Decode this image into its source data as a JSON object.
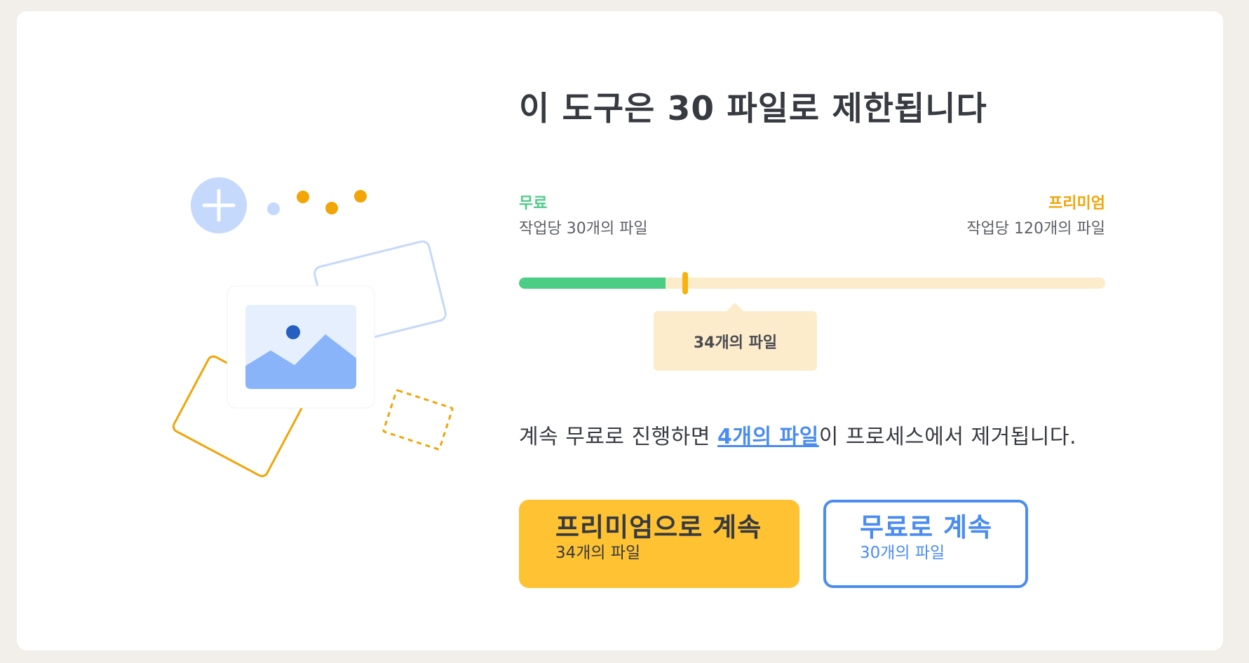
{
  "title": "이 도구은 30 파일로 제한됩니다",
  "plans": {
    "free": {
      "label": "무료",
      "desc": "작업당 30개의 파일",
      "color": "#4ccd86"
    },
    "premium": {
      "label": "프리미엄",
      "desc": "작업당 120개의 파일",
      "color": "#f1a508"
    }
  },
  "usage": {
    "free_limit_fraction": 0.25,
    "current_fraction": 0.2833,
    "tooltip": "34개의 파일"
  },
  "message": {
    "prefix": "계속 무료로 진행하면 ",
    "link": "4개의 파일",
    "suffix": "이 프로세스에서 제거됩니다."
  },
  "buttons": {
    "premium": {
      "title": "프리미엄으로 계속",
      "sub": "34개의 파일"
    },
    "free": {
      "title": "무료로 계속",
      "sub": "30개의 파일"
    }
  },
  "illustration": {
    "icons": [
      "plus-icon",
      "image-icon",
      "dots-icon"
    ],
    "accent_blue": "#4a8cf0",
    "accent_yellow": "#f1a508"
  }
}
